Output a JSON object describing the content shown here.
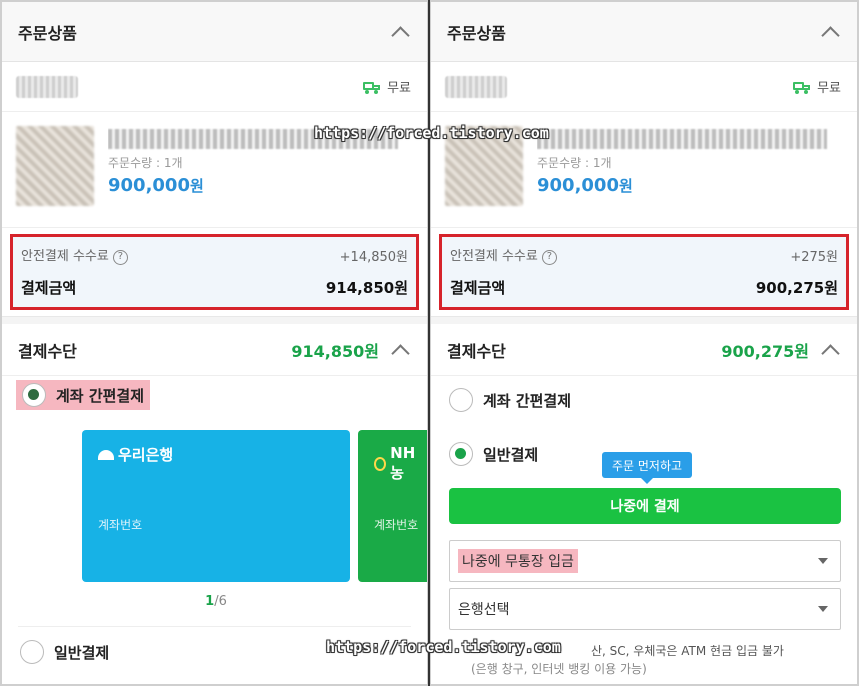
{
  "left": {
    "order_section": {
      "title": "주문상품"
    },
    "shipping": {
      "label": "무료"
    },
    "product": {
      "qty_label": "주문수량 : 1개",
      "price": "900,000",
      "won": "원"
    },
    "fee": {
      "label": "안전결제 수수료",
      "value": "+14,850원",
      "total_label": "결제금액",
      "total_value": "914,850원"
    },
    "payment": {
      "title": "결제수단",
      "amount": "914,850원",
      "option_easy": "계좌 간편결제",
      "option_general": "일반결제",
      "cards": [
        {
          "bank": "우리은행",
          "acct_label": "계좌번호",
          "color": "#17b2e6"
        },
        {
          "bank": "NH농",
          "acct_label": "계좌번호",
          "color": "#1aaa47"
        }
      ],
      "pager": {
        "current": "1",
        "total": "/6"
      }
    }
  },
  "right": {
    "order_section": {
      "title": "주문상품"
    },
    "shipping": {
      "label": "무료"
    },
    "product": {
      "qty_label": "주문수량 : 1개",
      "price": "900,000",
      "won": "원"
    },
    "fee": {
      "label": "안전결제 수수료",
      "value": "+275원",
      "total_label": "결제금액",
      "total_value": "900,275원"
    },
    "payment": {
      "title": "결제수단",
      "amount": "900,275원",
      "option_easy": "계좌 간편결제",
      "option_general": "일반결제",
      "tooltip": "주문 먼저하고",
      "pay_later_button": "나중에 결제",
      "deposit_select": "나중에 무통장 입금",
      "bank_select": "은행선택",
      "note_line1": "산, SC, 우체국은 ATM 현금 입금 불가",
      "note_line2": "(은행 창구, 인터넷 뱅킹 이용 가능)"
    }
  },
  "watermark": "https://forced.tistory.com",
  "colors": {
    "accent_green": "#1aa34a",
    "highlight_red": "#d6232b",
    "price_blue": "#2b8fd6"
  }
}
